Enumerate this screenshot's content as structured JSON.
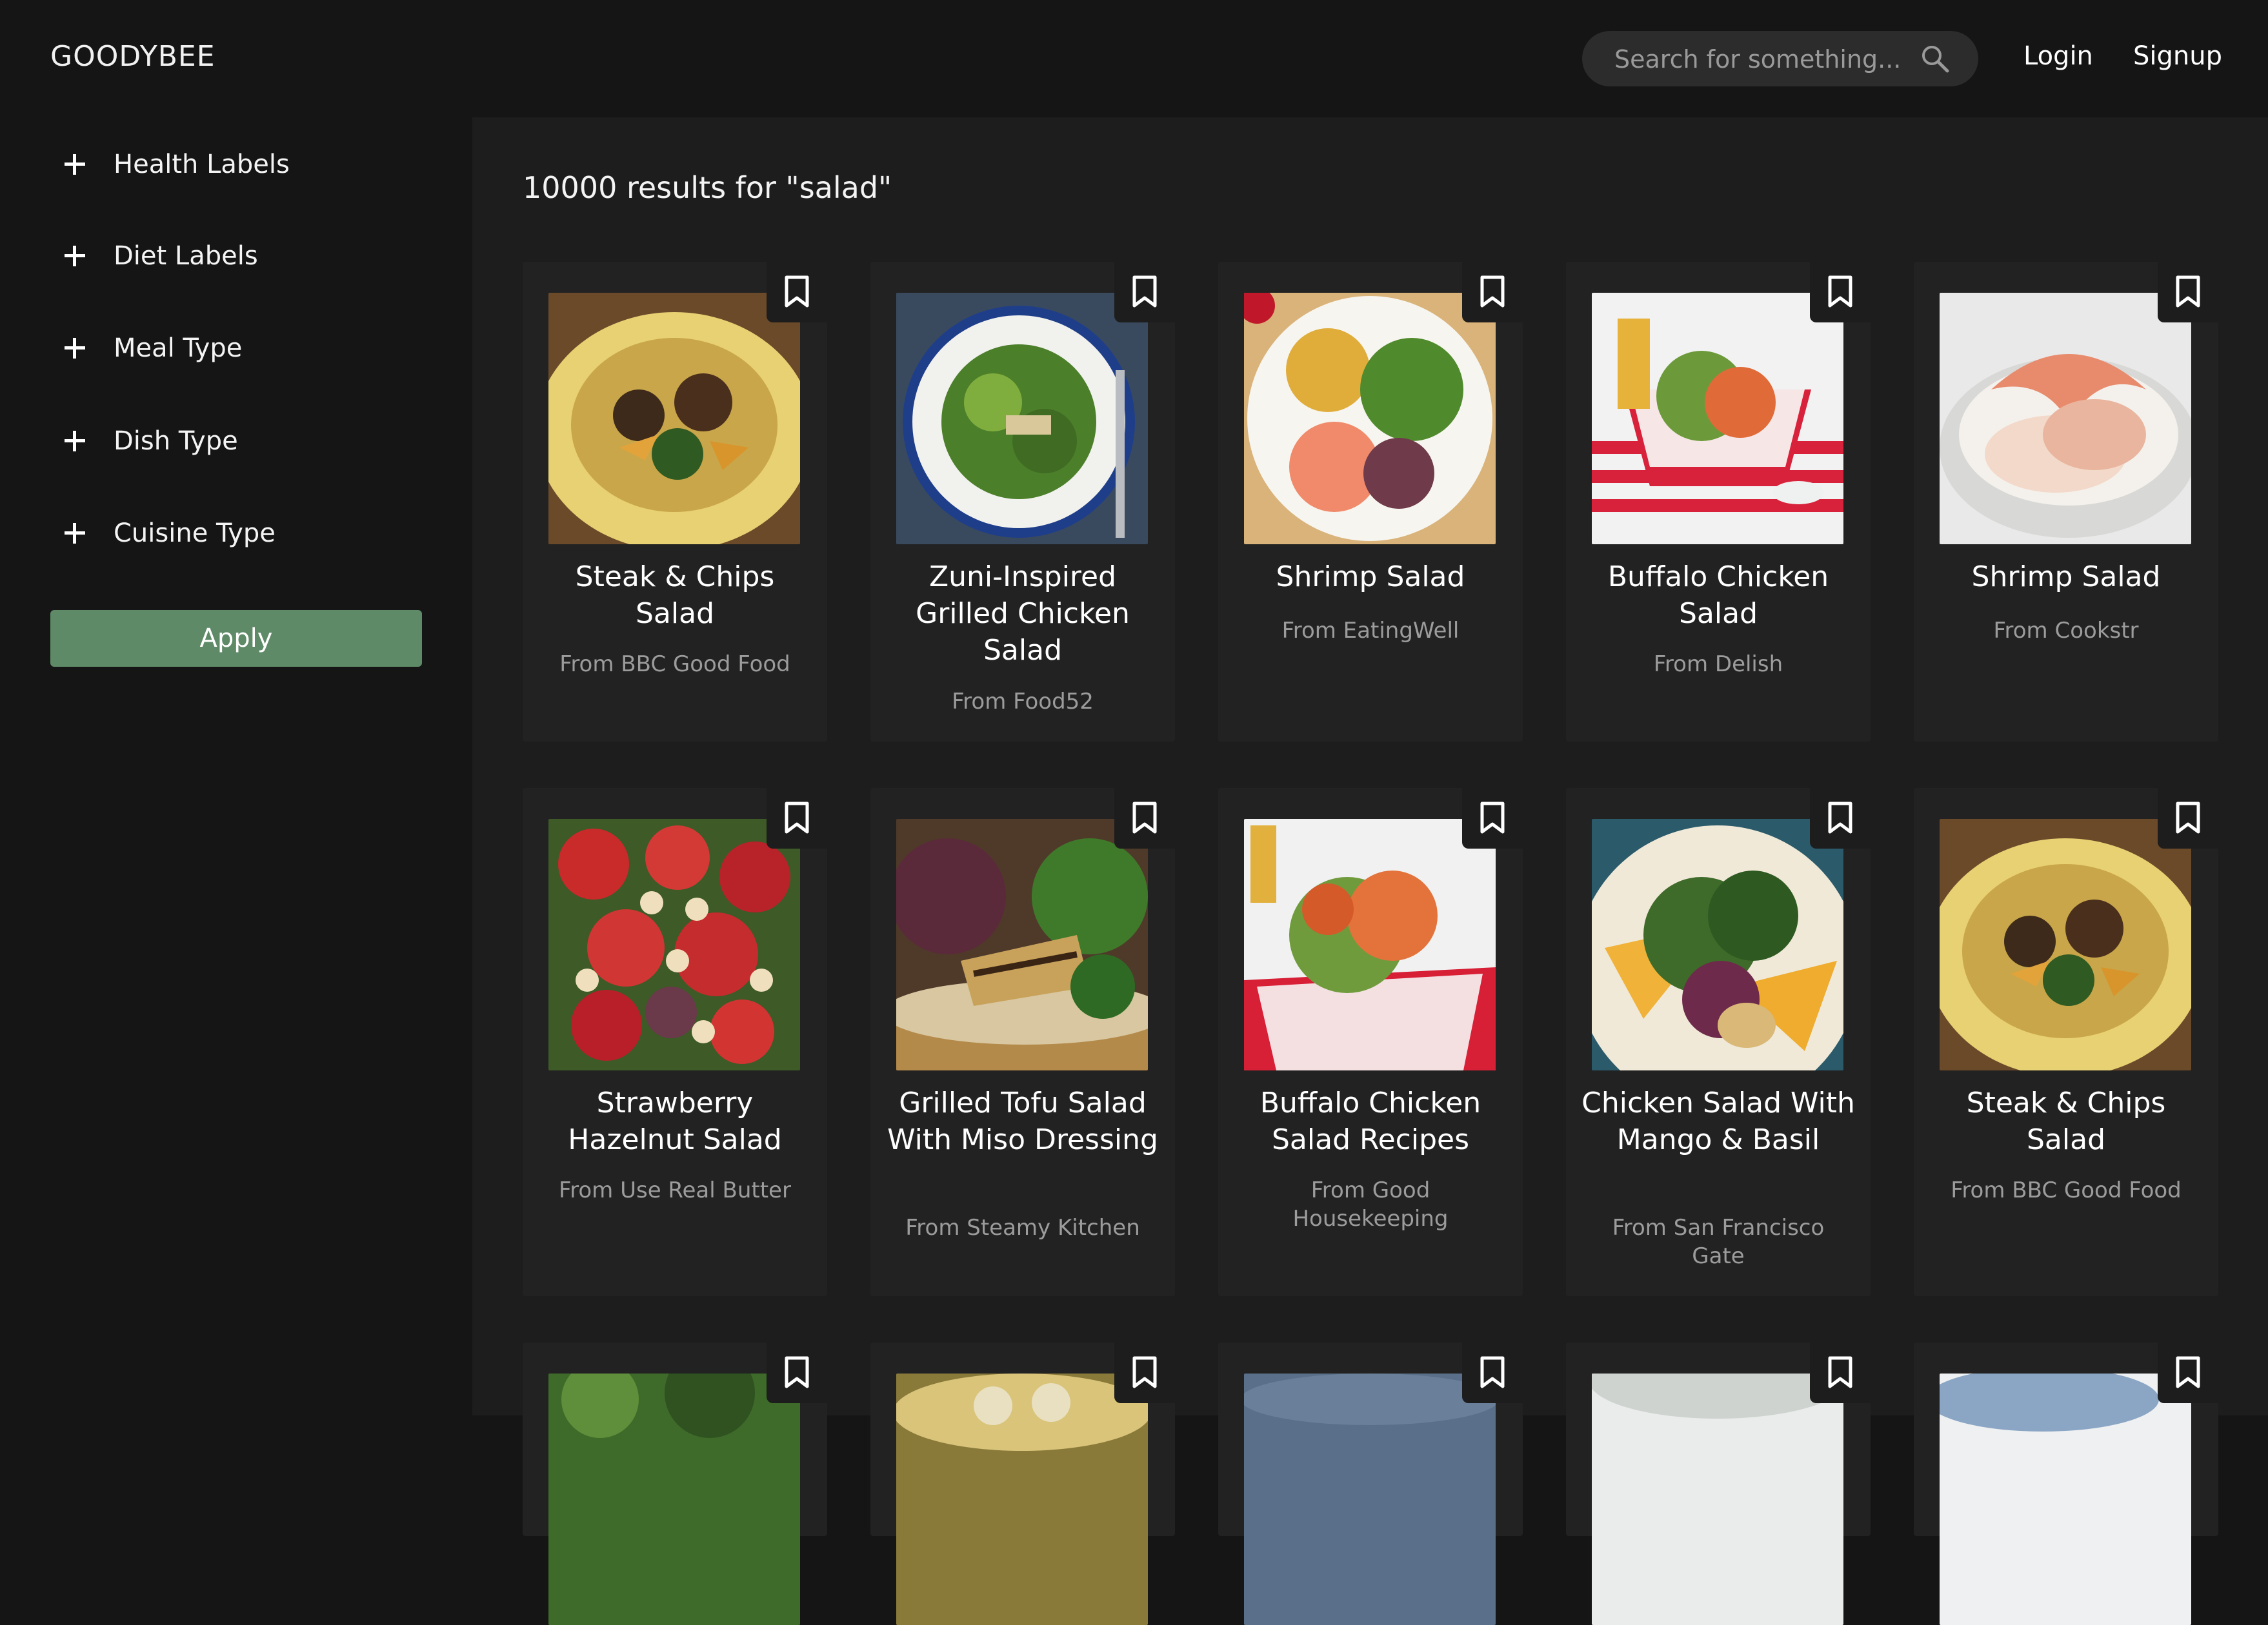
{
  "header": {
    "brand": "GOODYBEE",
    "search_placeholder": "Search for something...",
    "login": "Login",
    "signup": "Signup"
  },
  "sidebar": {
    "filters": [
      {
        "label": "Health Labels"
      },
      {
        "label": "Diet Labels"
      },
      {
        "label": "Meal Type"
      },
      {
        "label": "Dish Type"
      },
      {
        "label": "Cuisine Type"
      }
    ],
    "apply_label": "Apply"
  },
  "main": {
    "results_text": "10000 results for \"salad\"",
    "recipes": [
      {
        "title": "Steak & Chips Salad",
        "source": "From BBC Good Food",
        "image": "steak-salad-plate"
      },
      {
        "title": "Zuni-Inspired Grilled Chicken Salad",
        "source": "From Food52",
        "image": "greens-plate"
      },
      {
        "title": "Shrimp Salad",
        "source": "From EatingWell",
        "image": "shrimp-chickpea-plate"
      },
      {
        "title": "Buffalo Chicken Salad",
        "source": "From Delish",
        "image": "buffalo-basket"
      },
      {
        "title": "Shrimp Salad",
        "source": "From Cookstr",
        "image": "shrimp-bowl"
      },
      {
        "title": "Strawberry Hazelnut Salad",
        "source": "From Use Real Butter",
        "image": "strawberry-salad"
      },
      {
        "title": "Grilled Tofu Salad With Miso Dressing",
        "source": "From Steamy Kitchen",
        "image": "tofu-salad"
      },
      {
        "title": "Buffalo Chicken Salad Recipes",
        "source": "From Good Housekeeping",
        "image": "buffalo-basket-2"
      },
      {
        "title": "Chicken Salad With Mango & Basil",
        "source": "From San Francisco Gate",
        "image": "mango-salad"
      },
      {
        "title": "Steak & Chips Salad",
        "source": "From BBC Good Food",
        "image": "steak-salad-plate"
      },
      {
        "title": "",
        "source": "",
        "image": "greens-partial"
      },
      {
        "title": "",
        "source": "",
        "image": "bowl-partial"
      },
      {
        "title": "",
        "source": "",
        "image": "blue-partial"
      },
      {
        "title": "",
        "source": "",
        "image": "white-plate-partial"
      },
      {
        "title": "",
        "source": "",
        "image": "blue-bowl-partial"
      }
    ]
  },
  "colors": {
    "page_bg": "#151515",
    "main_bg": "#1d1d1d",
    "card_bg": "#222222",
    "apply_green": "#5e8a67",
    "source_text": "#9c9c9c"
  },
  "icons": {
    "search": "search-icon",
    "filter_expand": "plus-icon",
    "save": "bookmark-icon"
  }
}
